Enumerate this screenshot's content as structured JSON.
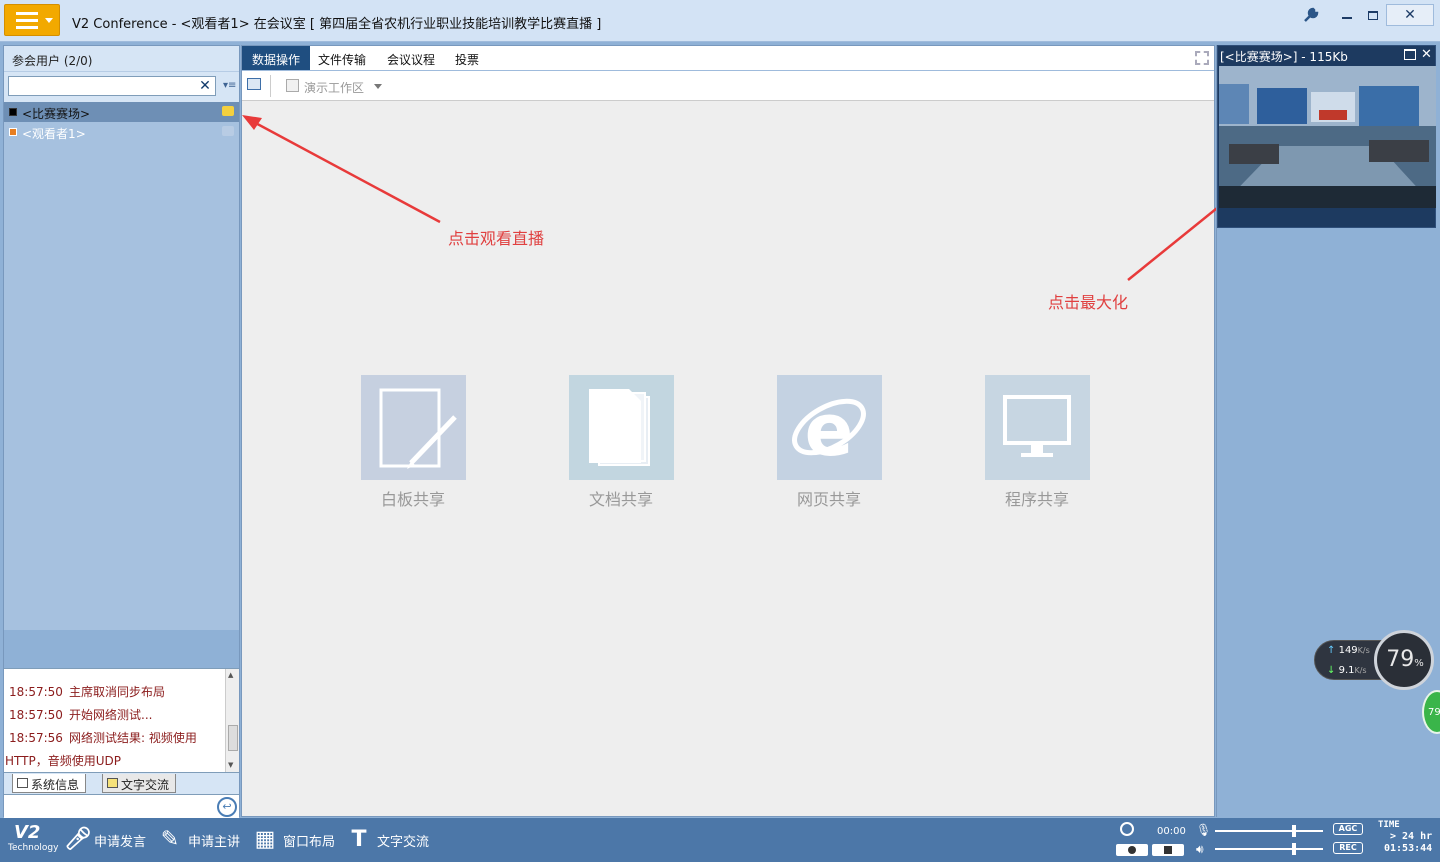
{
  "titlebar": {
    "title": "V2 Conference - <观看者1> 在会议室 [ 第四届全省农机行业职业技能培训教学比赛直播 ]",
    "accent": "#f2a900"
  },
  "users": {
    "header": "参会用户 (2/0)",
    "search_value": "",
    "list": [
      {
        "name": "<比赛赛场>",
        "selected": true,
        "square_color": "#000000",
        "cam_color": "#f4d03f"
      },
      {
        "name": "<观看者1>",
        "selected": false,
        "square_color": "#e67e22",
        "cam_color": "#b8cce4"
      }
    ]
  },
  "log": {
    "lines": [
      {
        "time": "18:57:50",
        "text": "主席取消同步布局"
      },
      {
        "time": "18:57:50",
        "text": "开始网络测试..."
      },
      {
        "time": "18:57:56",
        "text": "网络测试结果:  视频使用"
      }
    ],
    "tail": "HTTP，音频使用UDP",
    "tabs": [
      "系统信息",
      "文字交流"
    ]
  },
  "center": {
    "tabs": [
      "数据操作",
      "文件传输",
      "会议议程",
      "投票"
    ],
    "active_tab": 0,
    "toolbar_workspace": "演示工作区",
    "shares": [
      {
        "label": "白板共享",
        "icon": "whiteboard-icon",
        "color": "#c6d0e0"
      },
      {
        "label": "文档共享",
        "icon": "document-icon",
        "color": "#c2d6e0"
      },
      {
        "label": "网页共享",
        "icon": "browser-icon",
        "color": "#c4d2e2"
      },
      {
        "label": "程序共享",
        "icon": "monitor-icon",
        "color": "#c7d6e2"
      }
    ]
  },
  "annotations": {
    "watch_live": "点击观看直播",
    "maximize": "点击最大化"
  },
  "video": {
    "title": "[<比赛赛场>] - 115Kb"
  },
  "network": {
    "up": "149",
    "down": "9.1",
    "unit": "K/s",
    "gauge_pct": "79",
    "pct_sign": "%",
    "green_badge": "79"
  },
  "bottombar": {
    "logo_tech": "Technology",
    "items": [
      "申请发言",
      "申请主讲",
      "窗口布局",
      "文字交流"
    ],
    "elapsed": "00:00",
    "agc": "AGC",
    "rec": "REC",
    "time_label": "TIME",
    "hr_label": "> 24 hr",
    "clock": "01:53:44"
  }
}
